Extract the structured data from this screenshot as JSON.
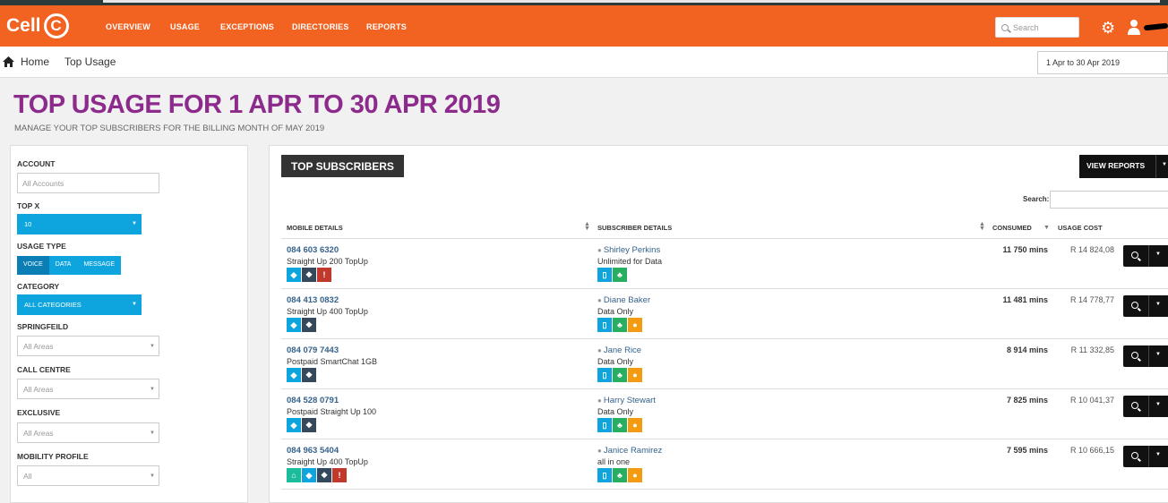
{
  "brand": {
    "logo_text": "Cell",
    "logo_c": "C",
    "accent": "#f26322",
    "title_color": "#8c2b8b"
  },
  "nav": {
    "items": [
      "OVERVIEW",
      "USAGE",
      "EXCEPTIONS",
      "DIRECTORIES",
      "REPORTS"
    ],
    "search_placeholder": "Search"
  },
  "breadcrumb": {
    "home": "Home",
    "current": "Top Usage"
  },
  "date_range": "1 Apr to 30 Apr 2019",
  "page": {
    "title": "TOP USAGE FOR 1 APR TO 30 APR 2019",
    "subtitle": "MANAGE YOUR TOP SUBSCRIBERS FOR THE BILLING MONTH OF MAY 2019"
  },
  "filters": {
    "account_label": "ACCOUNT",
    "account_placeholder": "All Accounts",
    "topx_label": "TOP X",
    "topx_value": "10",
    "usage_type_label": "USAGE TYPE",
    "usage_types": [
      "VOICE",
      "DATA",
      "MESSAGE"
    ],
    "category_label": "CATEGORY",
    "category_value": "ALL CATEGORIES",
    "springfeild_label": "SPRINGFEILD",
    "springfeild_value": "All Areas",
    "call_centre_label": "CALL CENTRE",
    "call_centre_value": "All Areas",
    "exclusive_label": "EXCLUSIVE",
    "exclusive_value": "All Areas",
    "mobility_label": "MOBILITY PROFILE",
    "mobility_value": "All"
  },
  "panel": {
    "title": "TOP SUBSCRIBERS",
    "view_reports": "VIEW REPORTS",
    "search_label": "Search:"
  },
  "columns": {
    "mobile": "MOBILE DETAILS",
    "subscriber": "SUBSCRIBER DETAILS",
    "consumed": "CONSUMED",
    "cost": "USAGE COST"
  },
  "rows": [
    {
      "mobile": "084 603 6320",
      "plan": "Straight Up 200 TopUp",
      "name": "Shirley Perkins",
      "type": "Unlimited for Data",
      "consumed": "11 750 mins",
      "cost": "R 14 824,08"
    },
    {
      "mobile": "084 413 0832",
      "plan": "Straight Up 400 TopUp",
      "name": "Diane Baker",
      "type": "Data Only",
      "consumed": "11 481 mins",
      "cost": "R 14 778,77"
    },
    {
      "mobile": "084 079 7443",
      "plan": "Postpaid SmartChat 1GB",
      "name": "Jane Rice",
      "type": "Data Only",
      "consumed": "8 914 mins",
      "cost": "R 11 332,85"
    },
    {
      "mobile": "084 528 0791",
      "plan": "Postpaid Straight Up 100",
      "name": "Harry Stewart",
      "type": "Data Only",
      "consumed": "7 825 mins",
      "cost": "R 10 041,37"
    },
    {
      "mobile": "084 963 5404",
      "plan": "Straight Up 400 TopUp",
      "name": "Janice Ramirez",
      "type": "all in one",
      "consumed": "7 595 mins",
      "cost": "R 10 666,15"
    }
  ]
}
